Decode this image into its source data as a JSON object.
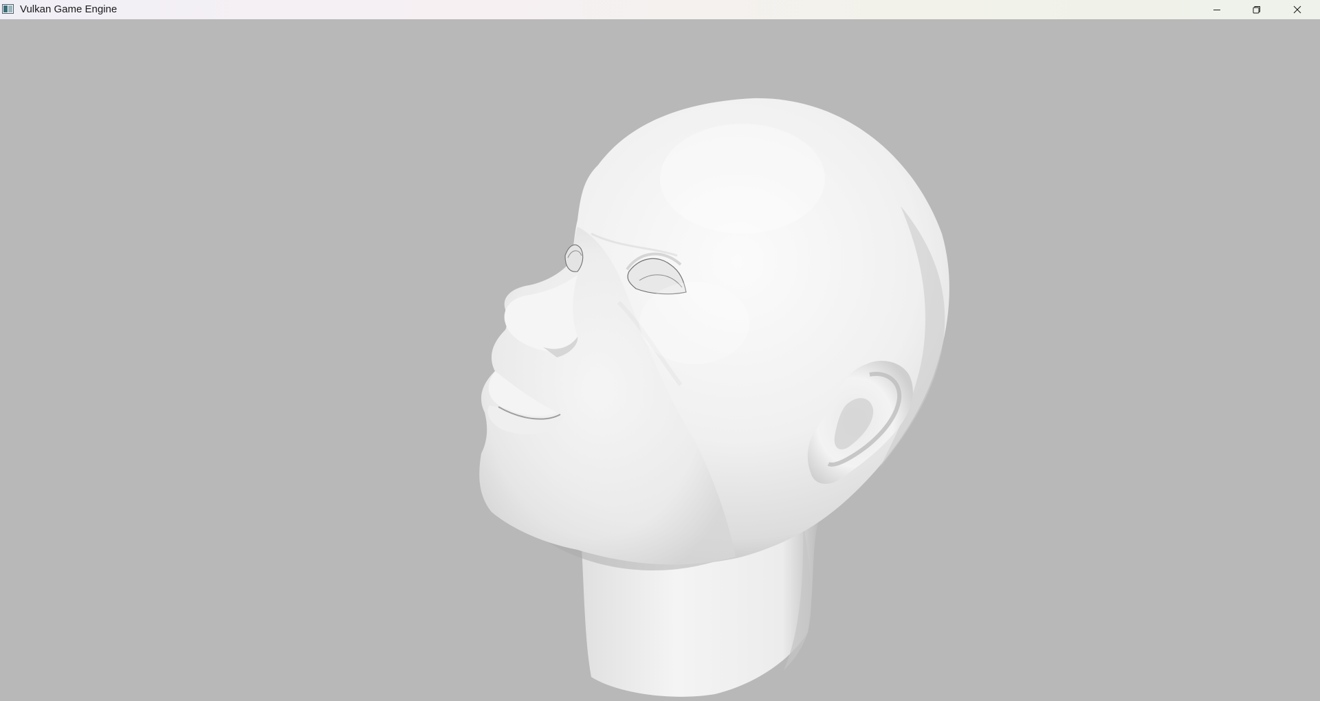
{
  "window": {
    "title": "Vulkan Game Engine",
    "controls": {
      "minimize": "minimize-icon",
      "restore": "restore-icon",
      "close": "close-icon"
    }
  },
  "viewport": {
    "background_color": "#b8b8b8",
    "model": "head-mesh",
    "model_color": "#f2f2f2"
  }
}
